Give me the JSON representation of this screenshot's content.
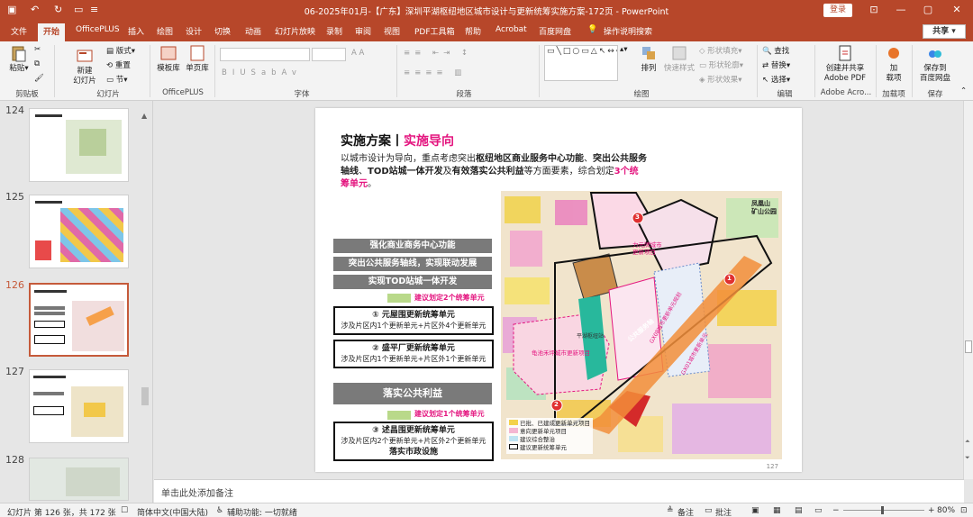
{
  "titlebar": {
    "title": "06-2025年01月-【广东】深圳平湖枢纽地区城市设计与更新统筹实施方案-172页 - PowerPoint",
    "login": "登录",
    "quick_access": [
      "save-icon",
      "undo-icon",
      "redo-icon",
      "present-icon",
      "customize-icon"
    ]
  },
  "tabs": [
    "文件",
    "开始",
    "OfficePLUS",
    "插入",
    "绘图",
    "设计",
    "切换",
    "动画",
    "幻灯片放映",
    "录制",
    "审阅",
    "视图",
    "PDF工具箱",
    "帮助",
    "Acrobat",
    "百度网盘",
    "操作说明搜索"
  ],
  "active_tab": "开始",
  "share": "共享",
  "ribbon": {
    "clipboard": {
      "paste": "粘贴",
      "label": "剪贴板"
    },
    "slides": {
      "new_slide": "新建\n幻灯片",
      "layout": "版式",
      "reset": "重置",
      "section": "节",
      "label": "幻灯片"
    },
    "officeplus": {
      "template": "模板库",
      "single": "单页库",
      "label": "OfficePLUS"
    },
    "font": {
      "label": "字体"
    },
    "paragraph": {
      "label": "段落"
    },
    "drawing": {
      "arrange": "排列",
      "quick_style": "快速样式",
      "fill": "形状填充",
      "outline": "形状轮廓",
      "effect": "形状效果",
      "label": "绘图"
    },
    "editing": {
      "find": "查找",
      "replace": "替换",
      "select": "选择",
      "label": "编辑"
    },
    "adobe": {
      "create_share": "创建并共享\nAdobe PDF",
      "label": "Adobe Acro..."
    },
    "addins": {
      "addin": "加\n载项",
      "label": "加载项"
    },
    "save": {
      "save_to_baidu": "保存到\n百度网盘",
      "label": "保存"
    }
  },
  "thumbnails": [
    {
      "num": "124",
      "selected": false
    },
    {
      "num": "125",
      "selected": false
    },
    {
      "num": "126",
      "selected": true
    },
    {
      "num": "127",
      "selected": false
    },
    {
      "num": "128",
      "selected": false
    }
  ],
  "slide": {
    "title_main": "实施方案",
    "title_sub": "实施导向",
    "body_1": "以城市设计为导向，重点考虑突出",
    "body_b1": "枢纽地区商业服务中心功能",
    "body_2": "、",
    "body_b2": "突出公共服务轴线",
    "body_3": "、",
    "body_b3": "TOD站城一体开发",
    "body_4": "及",
    "body_b4": "有效落实公共利益",
    "body_5": "等方面要素，综合划定",
    "body_p": "3个统筹单元",
    "body_6": "。",
    "bars": [
      "强化商业商务中心功能",
      "突出公共服务轴线，实现联动发展",
      "实现TOD站城一体开发"
    ],
    "note_1": "建议划定2个统筹单元",
    "unit1_title": "①  元屋围更新统筹单元",
    "unit1_desc": "涉及片区内1个更新单元+片区外4个更新单元",
    "unit2_title": "②  盛平厂更新统筹单元",
    "unit2_desc": "涉及片区内1个更新单元+片区外1个更新单元",
    "bar_public": "落实公共利益",
    "note_2": "建议划定1个统筹单元",
    "unit3_title": "③  述昌围更新统筹单元",
    "unit3_desc": "涉及片区内2个更新单元+片区外2个更新单元",
    "unit3_extra": "落实市政设施",
    "map_labels": {
      "park": "凤凰山\n矿山公园",
      "p1": "力元牌城市\n更新项目",
      "p2": "龟池禾坪城市更新项目",
      "axis": "公共服务轴",
      "p3": "GX08城市更新单元规划",
      "p4": "GX01城市更新单元",
      "station": "平湖枢纽站",
      "circle1": "1",
      "circle2": "2",
      "circle3": "3"
    },
    "legend": [
      "已批、已建成更新单元项目",
      "意向更新单元项目",
      "建议综合整治",
      "建议更新统筹单元"
    ],
    "page_number": "127"
  },
  "notes_placeholder": "单击此处添加备注",
  "status": {
    "slide_info": "幻灯片 第 126 张，共 172 张",
    "language": "简体中文(中国大陆)",
    "accessibility": "辅助功能: 一切就绪",
    "notes": "备注",
    "comments": "批注",
    "zoom": "80%"
  },
  "colors": {
    "accent": "#b7472a",
    "pink": "#e4157f"
  }
}
